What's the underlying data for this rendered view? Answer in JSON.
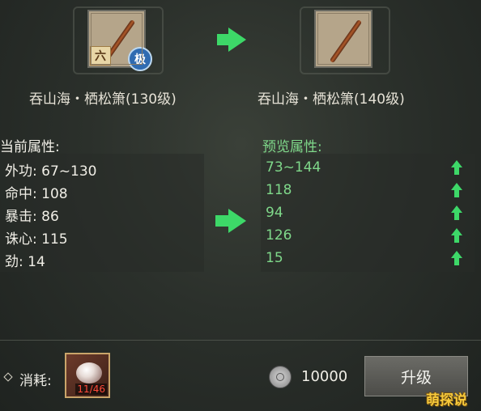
{
  "current_item": {
    "name": "吞山海・栖松箫(130级)",
    "badge_left": "六",
    "badge_right": "极",
    "icon": "flute-icon"
  },
  "preview_item": {
    "name": "吞山海・栖松箫(140级)",
    "icon": "flute-icon"
  },
  "current_stats": {
    "title": "当前属性:",
    "rows": [
      {
        "label": "外功",
        "value": "67~130"
      },
      {
        "label": "命中",
        "value": "108"
      },
      {
        "label": "暴击",
        "value": "86"
      },
      {
        "label": "诛心",
        "value": "115"
      },
      {
        "label": "劲",
        "value": "14"
      }
    ]
  },
  "preview_stats": {
    "title": "预览属性:",
    "rows": [
      {
        "value": "73~144"
      },
      {
        "value": "118"
      },
      {
        "value": "94"
      },
      {
        "value": "126"
      },
      {
        "value": "15"
      }
    ]
  },
  "footer": {
    "consume_label": "消耗:",
    "material_count": "11/46",
    "coin_icon": "silver-coin-icon",
    "coin_amount": "10000",
    "upgrade_label": "升级",
    "watermark": "萌探说"
  },
  "colors": {
    "accent_green": "#3dd868",
    "preview_text": "#7fd88a",
    "shortage_red": "#ff4a3a"
  }
}
